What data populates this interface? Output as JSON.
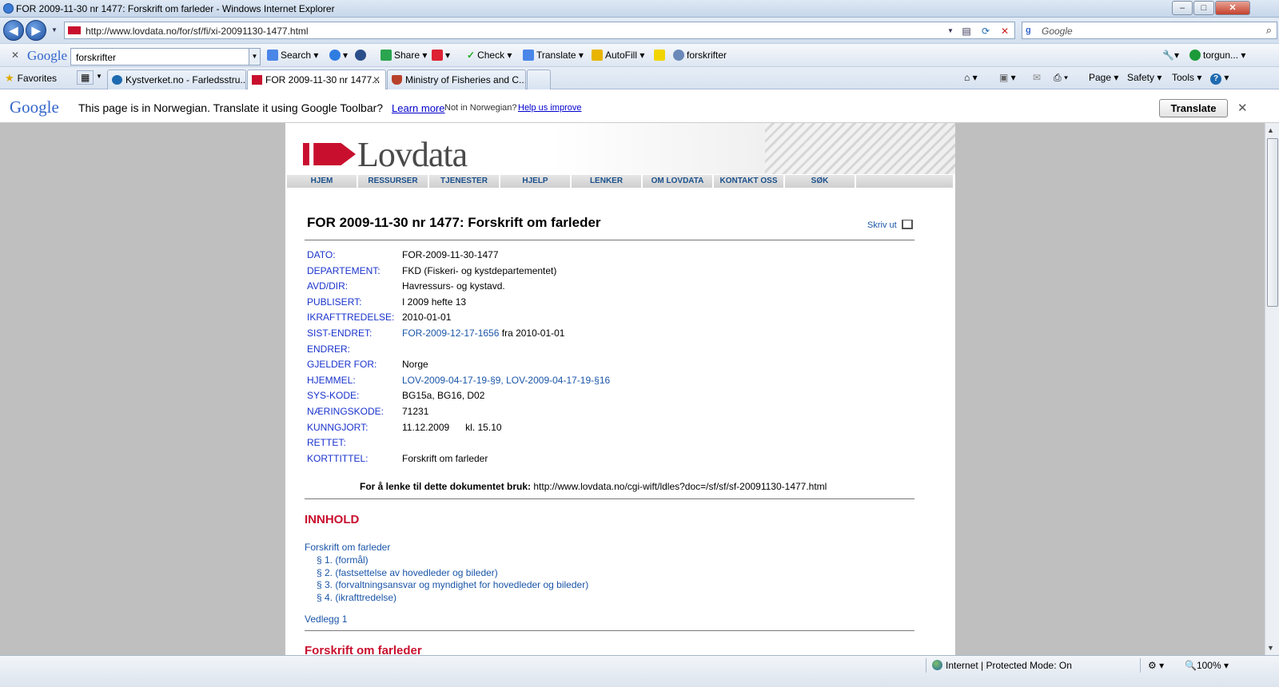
{
  "window": {
    "title": "FOR 2009-11-30 nr 1477: Forskrift om farleder - Windows Internet Explorer",
    "min": "–",
    "max": "□",
    "close": "✕"
  },
  "address": {
    "url": "http://www.lovdata.no/for/sf/fi/xi-20091130-1477.html",
    "search_placeholder": "Google",
    "back": "◀",
    "forward": "▶"
  },
  "google_toolbar": {
    "close": "✕",
    "logo": "Google",
    "query": "forskrifter",
    "search": "Search",
    "share": "Share",
    "check": "Check",
    "translate": "Translate",
    "autofill": "AutoFill",
    "highlight_term": "forskrifter",
    "account": "torgun..."
  },
  "tabs": {
    "favorites": "Favorites",
    "items": [
      {
        "label": "Kystverket.no - Farledsstru..."
      },
      {
        "label": "FOR 2009-11-30 nr 1477..."
      },
      {
        "label": "Ministry of Fisheries and C..."
      }
    ],
    "commands": {
      "page": "Page",
      "safety": "Safety",
      "tools": "Tools"
    }
  },
  "translate_bar": {
    "logo": "Google",
    "message": "This page is in Norwegian.  Translate it using Google Toolbar?",
    "learn_more": "Learn more",
    "not_in": "Not in Norwegian?",
    "help": "Help us improve",
    "button": "Translate",
    "close": "✕"
  },
  "site": {
    "logo_text": "Lovdata",
    "nav": [
      "HJEM",
      "RESSURSER",
      "TJENESTER",
      "HJELP",
      "LENKER",
      "OM LOVDATA",
      "KONTAKT OSS",
      "SØK"
    ]
  },
  "document": {
    "title": "FOR 2009-11-30 nr 1477: Forskrift om farleder",
    "print": "Skriv ut",
    "meta": [
      {
        "key": "DATO:",
        "value": "FOR-2009-11-30-1477"
      },
      {
        "key": "DEPARTEMENT:",
        "value": "FKD (Fiskeri- og kystdepartementet)"
      },
      {
        "key": "AVD/DIR:",
        "value": "Havressurs- og kystavd."
      },
      {
        "key": "PUBLISERT:",
        "value": "I 2009 hefte 13"
      },
      {
        "key": "IKRAFTTREDELSE:",
        "value": "2010-01-01"
      },
      {
        "key": "SIST-ENDRET:",
        "link": "FOR-2009-12-17-1656",
        "value": " fra 2010-01-01"
      },
      {
        "key": "ENDRER:",
        "value": ""
      },
      {
        "key": "GJELDER FOR:",
        "value": "Norge"
      },
      {
        "key": "HJEMMEL:",
        "link": "LOV-2009-04-17-19-§9, LOV-2009-04-17-19-§16",
        "value": ""
      },
      {
        "key": "SYS-KODE:",
        "value": "BG15a, BG16, D02"
      },
      {
        "key": "NÆRINGSKODE:",
        "value": "71231"
      },
      {
        "key": "KUNNGJORT:",
        "value": "11.12.2009      kl. 15.10"
      },
      {
        "key": "RETTET:",
        "value": ""
      },
      {
        "key": "KORTTITTEL:",
        "value": "Forskrift om farleder"
      }
    ],
    "link_label": "For å lenke til dette dokumentet bruk:",
    "link_url": "http://www.lovdata.no/cgi-wift/ldles?doc=/sf/sf/sf-20091130-1477.html",
    "toc_heading": "INNHOLD",
    "toc": [
      {
        "text": "Forskrift om farleder",
        "indent": false
      },
      {
        "text": "§ 1. (formål)",
        "indent": true
      },
      {
        "text": "§ 2. (fastsettelse av hovedleder og bileder)",
        "indent": true
      },
      {
        "text": "§ 3. (forvaltningsansvar og myndighet for hovedleder og bileder)",
        "indent": true
      },
      {
        "text": "§ 4. (ikrafttredelse)",
        "indent": true
      }
    ],
    "appendix": "Vedlegg 1",
    "section_heading": "Forskrift om farleder"
  },
  "status": {
    "zone": "Internet | Protected Mode: On",
    "zoom": "100%"
  }
}
